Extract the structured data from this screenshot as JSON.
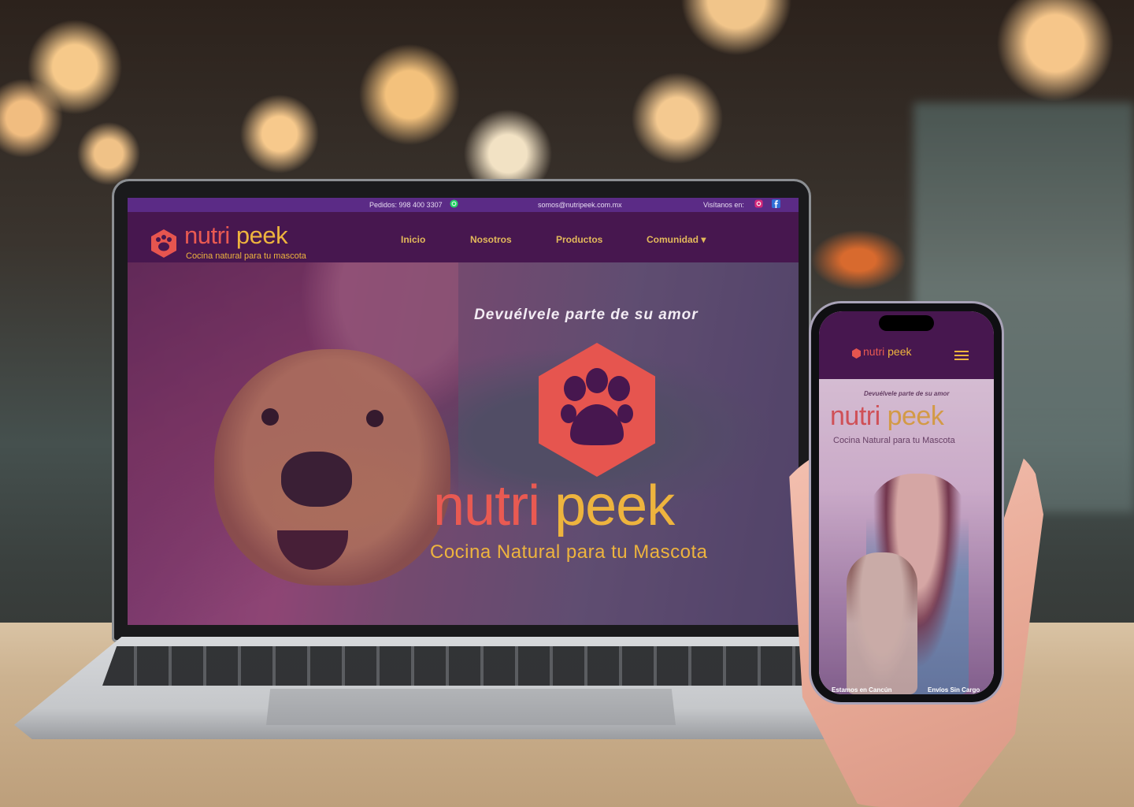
{
  "laptop_site": {
    "topbar": {
      "orders": "Pedidos: 998 400 3307",
      "email": "somos@nutripeek.com.mx",
      "visit": "Visítanos en:"
    },
    "brand": {
      "word_part1": "nutri",
      "word_part2": " peek",
      "tagline": "Cocina natural para tu mascota"
    },
    "nav": [
      {
        "label": "Inicio"
      },
      {
        "label": "Nosotros"
      },
      {
        "label": "Productos"
      },
      {
        "label": "Comunidad ▾"
      }
    ],
    "hero": {
      "tagline": "Devuélvele parte de su amor",
      "word_part1": "nutri",
      "word_part2": " peek",
      "subtitle": "Cocina Natural para tu Mascota"
    }
  },
  "phone_site": {
    "brand": {
      "word_part1": "nutri",
      "word_part2": " peek"
    },
    "hero": {
      "tagline": "Devuélvele parte de su amor",
      "word_part1": "nutri",
      "word_part2": " peek",
      "subtitle": "Cocina Natural para tu Mascota"
    },
    "footer": {
      "left": "Estamos en Cancún",
      "right": "Envíos Sin Cargo"
    }
  },
  "colors": {
    "brand_purple": "#47174f",
    "topbar_purple": "#5b2b86",
    "brand_red": "#e6554f",
    "brand_gold": "#eeb43e"
  },
  "icons": [
    "whatsapp-icon",
    "instagram-icon",
    "facebook-icon",
    "paw-icon",
    "menu-icon"
  ]
}
